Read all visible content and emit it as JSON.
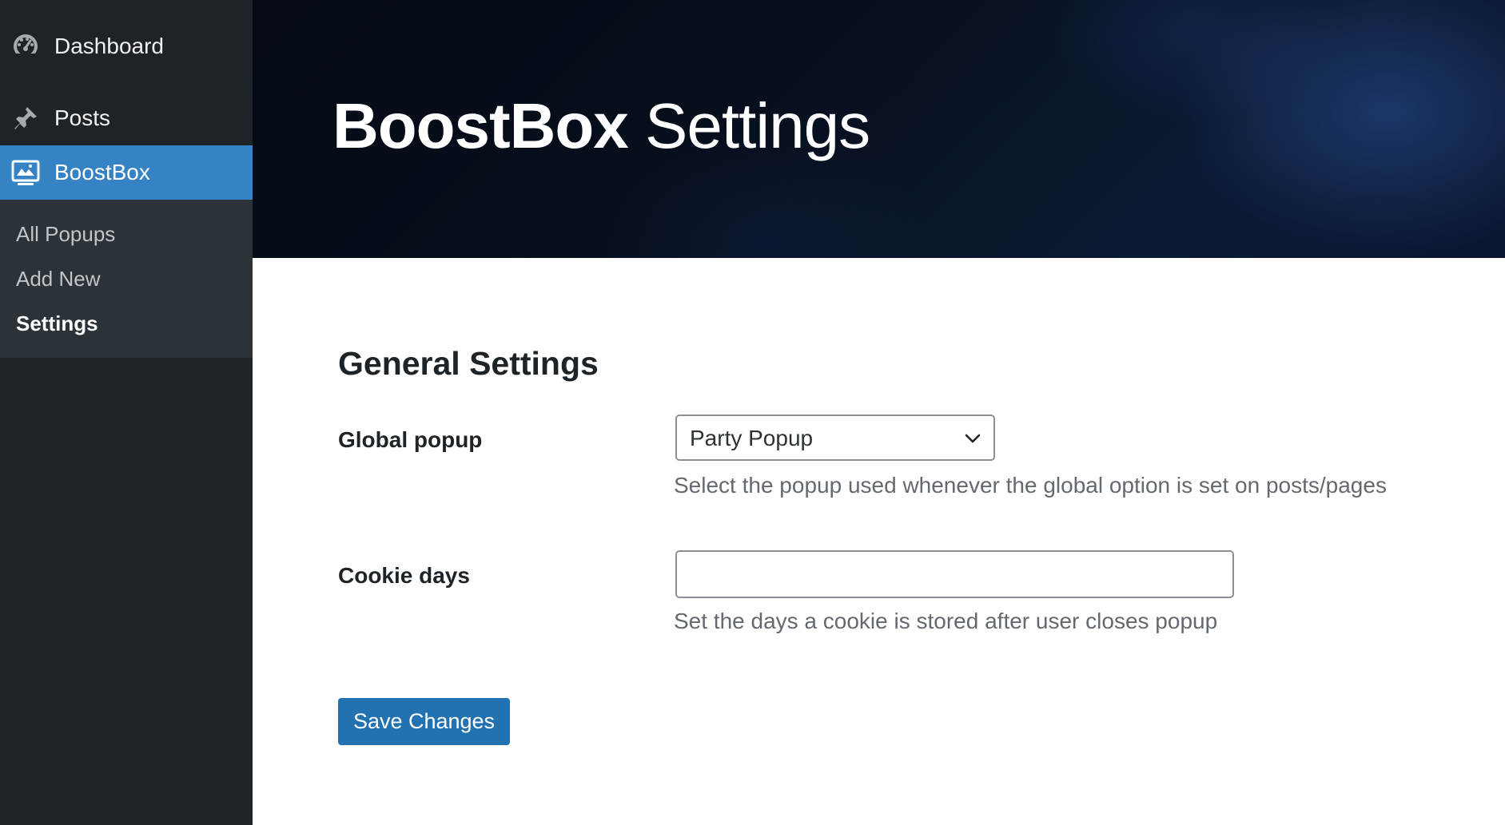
{
  "sidebar": {
    "items": [
      {
        "label": "Dashboard",
        "icon": "dashboard-gauge-icon"
      },
      {
        "label": "Posts",
        "icon": "pushpin-icon"
      },
      {
        "label": "BoostBox",
        "icon": "popup-window-icon",
        "active": true
      }
    ],
    "submenu": [
      {
        "label": "All Popups"
      },
      {
        "label": "Add New"
      },
      {
        "label": "Settings",
        "current": true
      }
    ]
  },
  "header": {
    "title_brand": "BoostBox",
    "title_rest": "Settings"
  },
  "settings": {
    "section_title": "General Settings",
    "global_popup": {
      "label": "Global popup",
      "selected": "Party Popup",
      "help": "Select the popup used whenever the global option is set on posts/pages"
    },
    "cookie_days": {
      "label": "Cookie days",
      "value": "",
      "help": "Set the days a cookie is stored after user closes popup"
    },
    "save_label": "Save Changes"
  },
  "colors": {
    "sidebar_bg": "#1d2327",
    "submenu_bg": "#2c3338",
    "active_item_bg": "#3582c4",
    "primary_button": "#2271b1",
    "help_text": "#646970"
  }
}
